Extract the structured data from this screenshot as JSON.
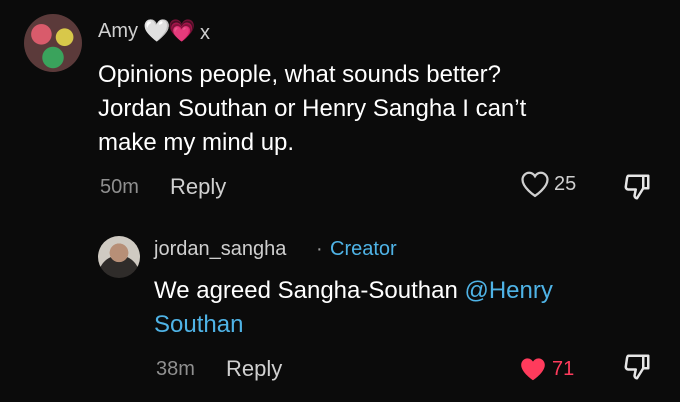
{
  "comment": {
    "username": "Amy",
    "hearts": [
      "🤍",
      "💗"
    ],
    "x": "x",
    "text_line1": "Opinions people, what sounds better?",
    "text_line2": "Jordan Southan or Henry Sangha I can’t",
    "text_line3": "make my mind up.",
    "time": "50m",
    "reply_label": "Reply",
    "likes": "25"
  },
  "reply": {
    "username": "jordan_sangha",
    "separator": "·",
    "badge": "Creator",
    "text_before": "We agreed Sangha-Southan ",
    "mention_line1": "@Henry",
    "mention_line2": "Southan",
    "time": "38m",
    "reply_label": "Reply",
    "likes": "71"
  },
  "colors": {
    "background": "#0b0b0b",
    "accent_blue": "#4fb3e6",
    "like_red": "#ff3b5c"
  }
}
